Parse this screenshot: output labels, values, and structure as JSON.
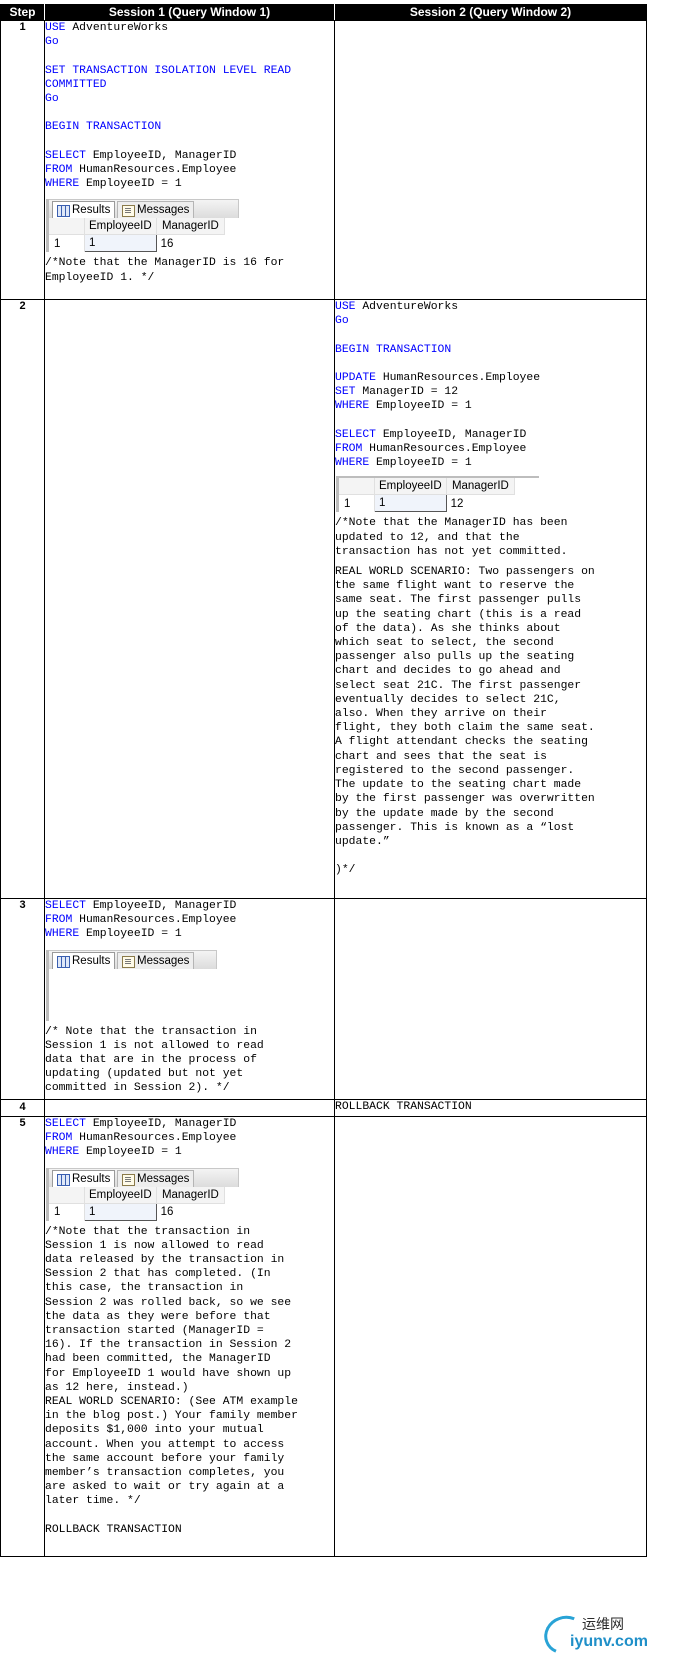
{
  "headers": {
    "step": "Step",
    "session1": "Session 1 (Query Window 1)",
    "session2": "Session 2 (Query Window 2)"
  },
  "steps": [
    "1",
    "2",
    "3",
    "4",
    "5"
  ],
  "sql": {
    "use": "USE",
    "db": " AdventureWorks",
    "go": "Go",
    "set_iso": "SET TRANSACTION ISOLATION LEVEL READ",
    "committed": "COMMITTED",
    "begin": "BEGIN TRANSACTION",
    "select": "SELECT",
    "select_cols": " EmployeeID, ManagerID",
    "from": "FROM",
    "from_tbl": " HumanResources.Employee",
    "where": "WHERE",
    "where_cond": " EmployeeID = 1",
    "update": "UPDATE",
    "update_tbl": " HumanResources.Employee",
    "set": "SET",
    "set_val": " ManagerID = 12",
    "rollback": "ROLLBACK TRANSACTION"
  },
  "results_widget": {
    "tab_results": "Results",
    "tab_messages": "Messages",
    "col1": "EmployeeID",
    "col2": "ManagerID",
    "row_num": "1"
  },
  "step1": {
    "emp": "1",
    "mgr": "16",
    "note": "/*Note that the ManagerID is 16 for\nEmployeeID 1. */"
  },
  "step2": {
    "emp": "1",
    "mgr": "12",
    "note": "/*Note that the ManagerID has been\nupdated to 12, and that the\ntransaction has not yet committed.",
    "scenario": "REAL WORLD SCENARIO: Two passengers on\nthe same flight want to reserve the\nsame seat. The first passenger pulls\nup the seating chart (this is a read\nof the data). As she thinks about\nwhich seat to select, the second\npassenger also pulls up the seating\nchart and decides to go ahead and\nselect seat 21C. The first passenger\neventually decides to select 21C,\nalso. When they arrive on their\nflight, they both claim the same seat.\nA flight attendant checks the seating\nchart and sees that the seat is\nregistered to the second passenger.\nThe update to the seating chart made\nby the first passenger was overwritten\nby the update made by the second\npassenger. This is known as a “lost\nupdate.”",
    "close": ")*/"
  },
  "step3": {
    "note": "/* Note that the transaction in\nSession 1 is not allowed to read\ndata that are in the process of\nupdating (updated but not yet\ncommitted in Session 2). */"
  },
  "step5": {
    "emp": "1",
    "mgr": "16",
    "note": "/*Note that the transaction in\nSession 1 is now allowed to read\ndata released by the transaction in\nSession 2 that has completed. (In\nthis case, the transaction in\nSession 2 was rolled back, so we see\nthe data as they were before that\ntransaction started (ManagerID =\n16). If the transaction in Session 2\nhad been committed, the ManagerID\nfor EmployeeID 1 would have shown up\nas 12 here, instead.)\nREAL WORLD SCENARIO: (See ATM example\nin the blog post.) Your family member\ndeposits $1,000 into your mutual\naccount. When you attempt to access\nthe same account before your family\nmember’s transaction completes, you\nare asked to wait or try again at a\nlater time. */"
  },
  "watermark": {
    "cn": "运维网",
    "en": "iyunv.com"
  },
  "colors": {
    "keyword": "#0000ff",
    "comment": "#008000",
    "header_bg": "#000000"
  }
}
